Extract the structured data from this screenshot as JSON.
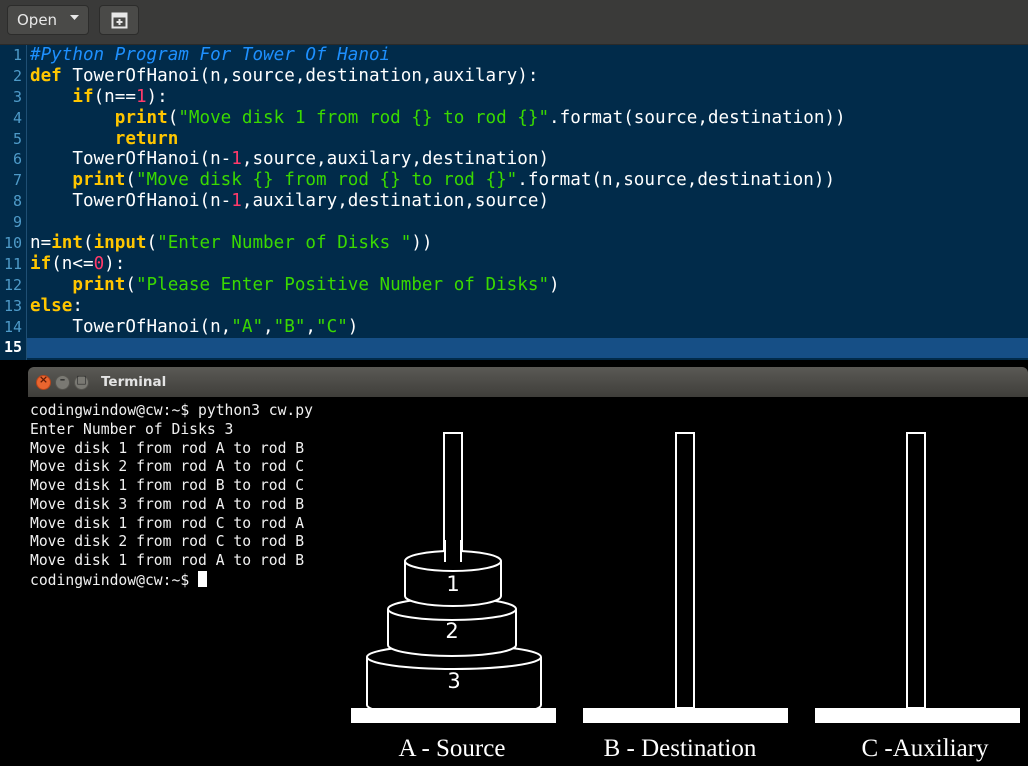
{
  "toolbar": {
    "open_label": "Open",
    "open_caret_icon": "caret-down-icon",
    "new_tab_icon": "new-document-icon"
  },
  "editor": {
    "line_numbers": [
      "1",
      "2",
      "3",
      "4",
      "5",
      "6",
      "7",
      "8",
      "9",
      "10",
      "11",
      "12",
      "13",
      "14",
      "15"
    ],
    "current_line": "15",
    "lines": [
      [
        {
          "t": "#Python Program For Tower Of Hanoi",
          "c": "cmt"
        }
      ],
      [
        {
          "t": "def",
          "c": "kw"
        },
        {
          "t": " TowerOfHanoi(n,source,destination,auxilary):"
        }
      ],
      [
        {
          "t": "    "
        },
        {
          "t": "if",
          "c": "kw"
        },
        {
          "t": "(n=="
        },
        {
          "t": "1",
          "c": "num"
        },
        {
          "t": "):"
        }
      ],
      [
        {
          "t": "        "
        },
        {
          "t": "print",
          "c": "kw"
        },
        {
          "t": "("
        },
        {
          "t": "\"Move disk 1 from rod {} to rod {}\"",
          "c": "str"
        },
        {
          "t": ".format(source,destination))"
        }
      ],
      [
        {
          "t": "        "
        },
        {
          "t": "return",
          "c": "kw"
        }
      ],
      [
        {
          "t": "    TowerOfHanoi(n-"
        },
        {
          "t": "1",
          "c": "num"
        },
        {
          "t": ",source,auxilary,destination)"
        }
      ],
      [
        {
          "t": "    "
        },
        {
          "t": "print",
          "c": "kw"
        },
        {
          "t": "("
        },
        {
          "t": "\"Move disk {} from rod {} to rod {}\"",
          "c": "str"
        },
        {
          "t": ".format(n,source,destination))"
        }
      ],
      [
        {
          "t": "    TowerOfHanoi(n-"
        },
        {
          "t": "1",
          "c": "num"
        },
        {
          "t": ",auxilary,destination,source)"
        }
      ],
      [
        {
          "t": ""
        }
      ],
      [
        {
          "t": "n="
        },
        {
          "t": "int",
          "c": "kw"
        },
        {
          "t": "("
        },
        {
          "t": "input",
          "c": "kw"
        },
        {
          "t": "("
        },
        {
          "t": "\"Enter Number of Disks \"",
          "c": "str"
        },
        {
          "t": "))"
        }
      ],
      [
        {
          "t": "if",
          "c": "kw"
        },
        {
          "t": "(n<="
        },
        {
          "t": "0",
          "c": "num"
        },
        {
          "t": "):"
        }
      ],
      [
        {
          "t": "    "
        },
        {
          "t": "print",
          "c": "kw"
        },
        {
          "t": "("
        },
        {
          "t": "\"Please Enter Positive Number of Disks\"",
          "c": "str"
        },
        {
          "t": ")"
        }
      ],
      [
        {
          "t": "else",
          "c": "kw"
        },
        {
          "t": ":"
        }
      ],
      [
        {
          "t": "    TowerOfHanoi(n,"
        },
        {
          "t": "\"A\"",
          "c": "str"
        },
        {
          "t": ","
        },
        {
          "t": "\"B\"",
          "c": "str"
        },
        {
          "t": ","
        },
        {
          "t": "\"C\"",
          "c": "str"
        },
        {
          "t": ")"
        }
      ],
      [
        {
          "t": ""
        }
      ]
    ]
  },
  "terminal": {
    "title": "Terminal",
    "buttons": [
      "close-icon",
      "minimize-icon",
      "maximize-icon"
    ],
    "output": [
      "codingwindow@cw:~$ python3 cw.py",
      "Enter Number of Disks 3",
      "Move disk 1 from rod A to rod B",
      "Move disk 2 from rod A to rod C",
      "Move disk 1 from rod B to rod C",
      "Move disk 3 from rod A to rod B",
      "Move disk 1 from rod C to rod A",
      "Move disk 2 from rod C to rod B",
      "Move disk 1 from rod A to rod B"
    ],
    "prompt": "codingwindow@cw:~$ "
  },
  "hanoi": {
    "rods": [
      "A - Source",
      "B - Destination",
      "C -Auxiliary"
    ],
    "disks": [
      "1",
      "2",
      "3"
    ]
  },
  "colors": {
    "editor_bg": "#012b4a",
    "current_line": "#164f86",
    "keyword": "#ffc600",
    "string": "#3ad900",
    "comment": "#1e90ff",
    "number": "#ff3a6a"
  }
}
